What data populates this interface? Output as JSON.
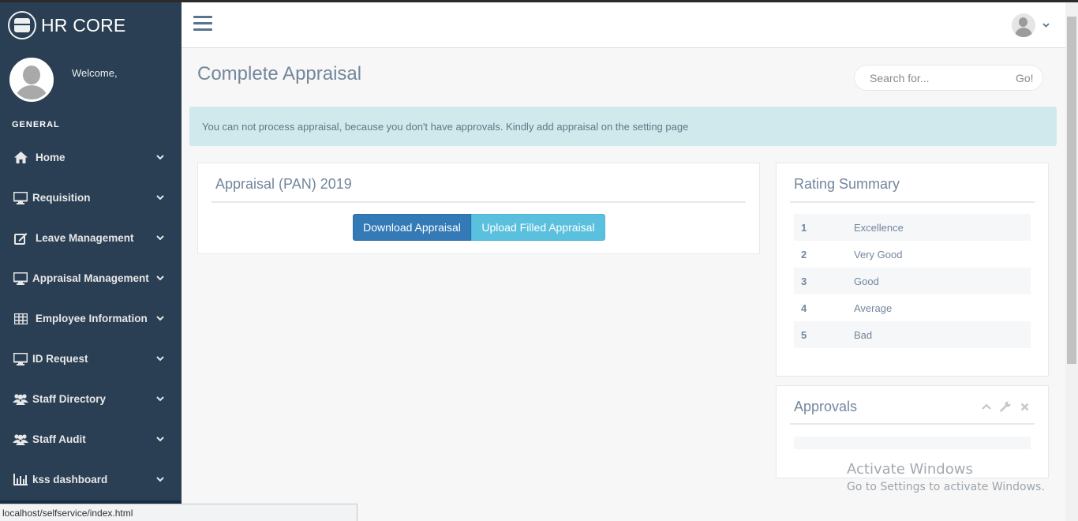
{
  "app": {
    "brand": "HR CORE",
    "welcome": "Welcome,"
  },
  "sidebar": {
    "section_label": "GENERAL",
    "items": [
      {
        "label": "Home",
        "icon": "home-icon"
      },
      {
        "label": "Requisition",
        "icon": "desktop-icon"
      },
      {
        "label": "Leave Management",
        "icon": "edit-icon"
      },
      {
        "label": "Appraisal Management",
        "icon": "desktop-icon"
      },
      {
        "label": "Employee Information",
        "icon": "table-icon"
      },
      {
        "label": "ID Request",
        "icon": "desktop-icon"
      },
      {
        "label": "Staff Directory",
        "icon": "users-icon"
      },
      {
        "label": "Staff Audit",
        "icon": "users-icon"
      },
      {
        "label": "kss dashboard",
        "icon": "bar-chart-icon"
      }
    ]
  },
  "header": {
    "user_menu_icon": "chevron-down-icon"
  },
  "main": {
    "page_title": "Complete Appraisal",
    "search": {
      "placeholder": "Search for...",
      "go_label": "Go!"
    },
    "alert": "You can not process appraisal, because you don't have approvals. Kindly add appraisal on the setting page",
    "appraisal_panel": {
      "title": "Appraisal (PAN) 2019",
      "download_label": "Download Appraisal",
      "upload_label": "Upload Filled Appraisal"
    },
    "rating_panel": {
      "title": "Rating Summary",
      "rows": [
        {
          "num": "1",
          "label": "Excellence"
        },
        {
          "num": "2",
          "label": "Very Good"
        },
        {
          "num": "3",
          "label": "Good"
        },
        {
          "num": "4",
          "label": "Average"
        },
        {
          "num": "5",
          "label": "Bad"
        }
      ]
    },
    "approvals_panel": {
      "title": "Approvals"
    }
  },
  "watermark": {
    "line1": "Activate Windows",
    "line2": "Go to Settings to activate Windows."
  },
  "status_url": "localhost/selfservice/index.html",
  "colors": {
    "sidebar": "#2a3f54",
    "primary": "#337ab7",
    "info": "#5bc0de",
    "alert_bg": "#d0e9ed",
    "text_muted": "#73879c"
  }
}
